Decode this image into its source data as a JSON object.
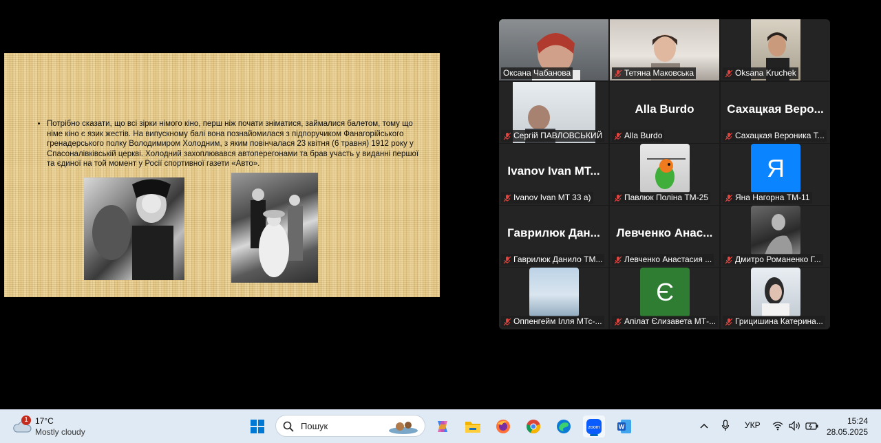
{
  "slide": {
    "text": "Потрібно сказати, що всі зірки німого кіно, перш ніж почати зніматися, займалися балетом, тому що німе кіно є язик жестів. На випускному балі вона познайомилася з підпоручиком Фанагорійського гренадерського полку Володимиром Холодним, з яким повінчалася 23 квітня (6 травня) 1912 року у Спасоналівківській церкві. Холодний захоплювався автоперегонами та брав участь у виданні першої та єдиної на той момент у Росії спортивної газети «Авто»."
  },
  "participants": [
    {
      "name": "Оксана Чабанова",
      "video": true,
      "muted": false,
      "active": true
    },
    {
      "name": "Тетяна Маковська",
      "video": true,
      "muted": true
    },
    {
      "name": "Oksana Kruchek",
      "video": true,
      "muted": true
    },
    {
      "name": "Сергій ПАВЛОВСЬКИЙ",
      "video": true,
      "muted": true
    },
    {
      "name": "Alla Burdo",
      "display": "Alla Burdo",
      "video": false,
      "muted": true
    },
    {
      "name": "Сахацкая Вероника Т...",
      "display": "Сахацкая Веро...",
      "video": false,
      "muted": true
    },
    {
      "name": "Ivanov Ivan MT 33 a)",
      "display": "Ivanov Ivan MT...",
      "video": false,
      "muted": true
    },
    {
      "name": "Павлюк Поліна ТМ-25",
      "video": true,
      "muted": true
    },
    {
      "name": "Яна Нагорна ТМ-11",
      "avatar_letter": "Я",
      "avatar_color": "#0a84ff",
      "muted": true
    },
    {
      "name": "Гаврилюк Данило ТМ...",
      "display": "Гаврилюк Дан...",
      "video": false,
      "muted": true
    },
    {
      "name": "Левченко Анастасия ...",
      "display": "Левченко Анас...",
      "video": false,
      "muted": true
    },
    {
      "name": "Дмитро Романенко Г...",
      "video": true,
      "muted": true
    },
    {
      "name": "Оппенгейм Ілля МТс-...",
      "video": true,
      "muted": true
    },
    {
      "name": "Апілат Єлизавета МТ-...",
      "avatar_letter": "Є",
      "avatar_color": "#2e7d32",
      "muted": true
    },
    {
      "name": "Грицишина Катерина...",
      "video": true,
      "muted": true
    }
  ],
  "taskbar": {
    "weather": {
      "badge": "1",
      "temp": "17°C",
      "condition": "Mostly cloudy"
    },
    "search_placeholder": "Пошук",
    "apps": [
      "start-icon",
      "copilot-icon",
      "file-explorer-icon",
      "firefox-icon",
      "chrome-icon",
      "edge-icon",
      "zoom-icon",
      "word-icon"
    ],
    "language": "УКР",
    "time": "15:24",
    "date": "28.05.2025"
  },
  "colors": {
    "active_speaker": "#23d959",
    "muted_icon": "#e0443e",
    "taskbar": "#dfeaf5"
  }
}
